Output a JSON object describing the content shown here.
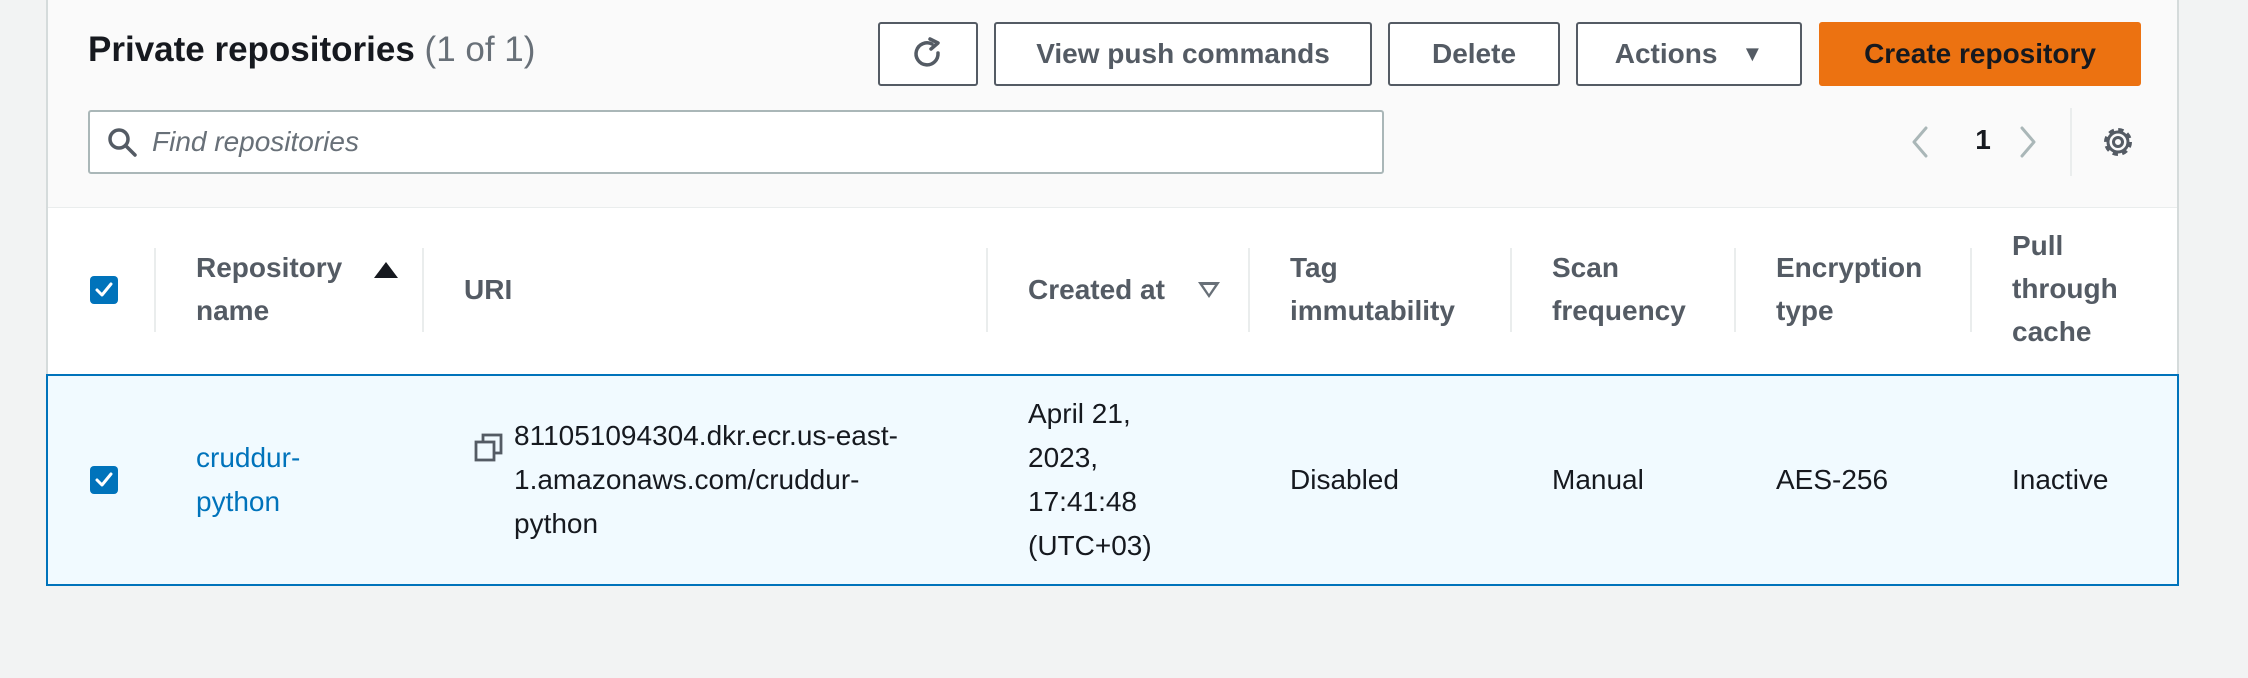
{
  "header": {
    "title": "Private repositories",
    "count": "(1 of 1)",
    "buttons": {
      "view_push_commands": "View push commands",
      "delete": "Delete",
      "actions": "Actions",
      "create_repository": "Create repository"
    }
  },
  "search": {
    "placeholder": "Find repositories",
    "value": ""
  },
  "pagination": {
    "current_page": "1"
  },
  "table": {
    "columns": {
      "repository_name": [
        "Repository",
        "name"
      ],
      "uri": "URI",
      "created_at": "Created at",
      "tag_immutability": [
        "Tag",
        "immutability"
      ],
      "scan_frequency": [
        "Scan",
        "frequency"
      ],
      "encryption_type": [
        "Encryption",
        "type"
      ],
      "pull_through_cache": [
        "Pull",
        "through",
        "cache"
      ]
    },
    "rows": [
      {
        "selected": true,
        "repository_name": [
          "cruddur-",
          "python"
        ],
        "uri": [
          "811051094304.dkr.ecr.us-east-",
          "1.amazonaws.com/cruddur-",
          "python"
        ],
        "created_at": [
          "April 21,",
          "2023,",
          "17:41:48",
          "(UTC+03)"
        ],
        "tag_immutability": "Disabled",
        "scan_frequency": "Manual",
        "encryption_type": "AES-256",
        "pull_through_cache": "Inactive"
      }
    ]
  },
  "colors": {
    "primary_button": "#ec7211",
    "link": "#0073bb",
    "selected_row_bg": "#f1faff",
    "selected_row_border": "#0073bb"
  }
}
